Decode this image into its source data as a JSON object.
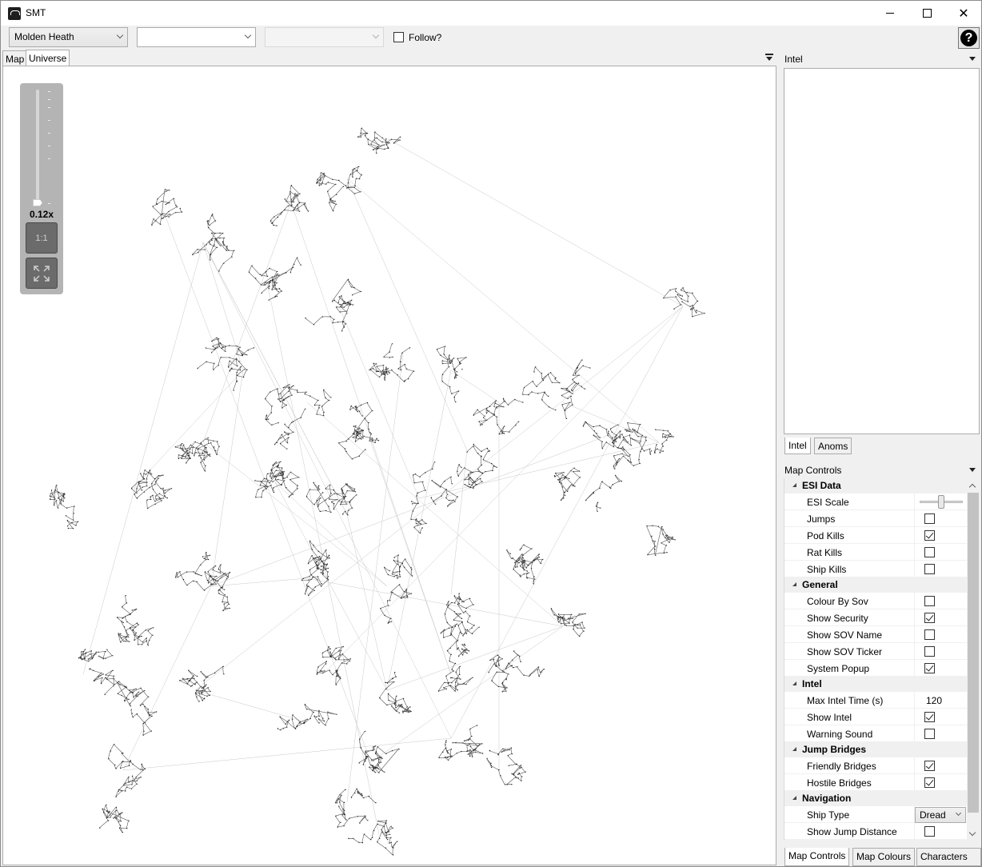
{
  "window": {
    "title": "SMT",
    "controls": {
      "minimize": "",
      "maximize": "",
      "close": "✕"
    }
  },
  "toolbar": {
    "region_value": "Molden Heath",
    "constellation_value": "",
    "system_value": "",
    "follow_label": "Follow?",
    "follow_checked": false,
    "help_label": "?"
  },
  "map_tabs": [
    {
      "label": "Map",
      "active": false
    },
    {
      "label": "Universe",
      "active": true
    }
  ],
  "zoom": {
    "level_label": "0.12x",
    "level_fraction": 0.03,
    "one_to_one_label": "1:1",
    "fit_icon": "expand-icon"
  },
  "intel_panel": {
    "header": "Intel",
    "tabs": [
      {
        "label": "Intel",
        "active": true
      },
      {
        "label": "Anoms",
        "active": false
      }
    ]
  },
  "map_controls": {
    "header": "Map Controls",
    "groups": [
      {
        "name": "ESI Data",
        "rows": [
          {
            "label": "ESI Scale",
            "type": "slider",
            "value": 0.5
          },
          {
            "label": "Jumps",
            "type": "checkbox",
            "checked": false
          },
          {
            "label": "Pod Kills",
            "type": "checkbox",
            "checked": true
          },
          {
            "label": "Rat Kills",
            "type": "checkbox",
            "checked": false
          },
          {
            "label": "Ship Kills",
            "type": "checkbox",
            "checked": false
          }
        ]
      },
      {
        "name": "General",
        "rows": [
          {
            "label": "Colour By Sov",
            "type": "checkbox",
            "checked": false
          },
          {
            "label": "Show Security",
            "type": "checkbox",
            "checked": true
          },
          {
            "label": "Show SOV Name",
            "type": "checkbox",
            "checked": false
          },
          {
            "label": "Show SOV Ticker",
            "type": "checkbox",
            "checked": false
          },
          {
            "label": "System Popup",
            "type": "checkbox",
            "checked": true
          }
        ]
      },
      {
        "name": "Intel",
        "rows": [
          {
            "label": "Max Intel Time (s)",
            "type": "text",
            "value": "120"
          },
          {
            "label": "Show Intel",
            "type": "checkbox",
            "checked": true
          },
          {
            "label": "Warning Sound",
            "type": "checkbox",
            "checked": false
          }
        ]
      },
      {
        "name": "Jump Bridges",
        "rows": [
          {
            "label": "Friendly Bridges",
            "type": "checkbox",
            "checked": true
          },
          {
            "label": "Hostile Bridges",
            "type": "checkbox",
            "checked": true
          }
        ]
      },
      {
        "name": "Navigation",
        "rows": [
          {
            "label": "Ship Type",
            "type": "select",
            "value": "Dread"
          },
          {
            "label": "Show Jump Distance",
            "type": "checkbox",
            "checked": false
          }
        ]
      }
    ]
  },
  "bottom_tabs": [
    {
      "label": "Map Controls",
      "active": true
    },
    {
      "label": "Map Colours",
      "active": false
    },
    {
      "label": "Characters",
      "active": false
    }
  ],
  "colors": {
    "map_background": "#ffffff",
    "map_lines": "#555555",
    "zoom_panel": "#b4b4b4",
    "zoom_buttons": "#6b6b6b"
  }
}
